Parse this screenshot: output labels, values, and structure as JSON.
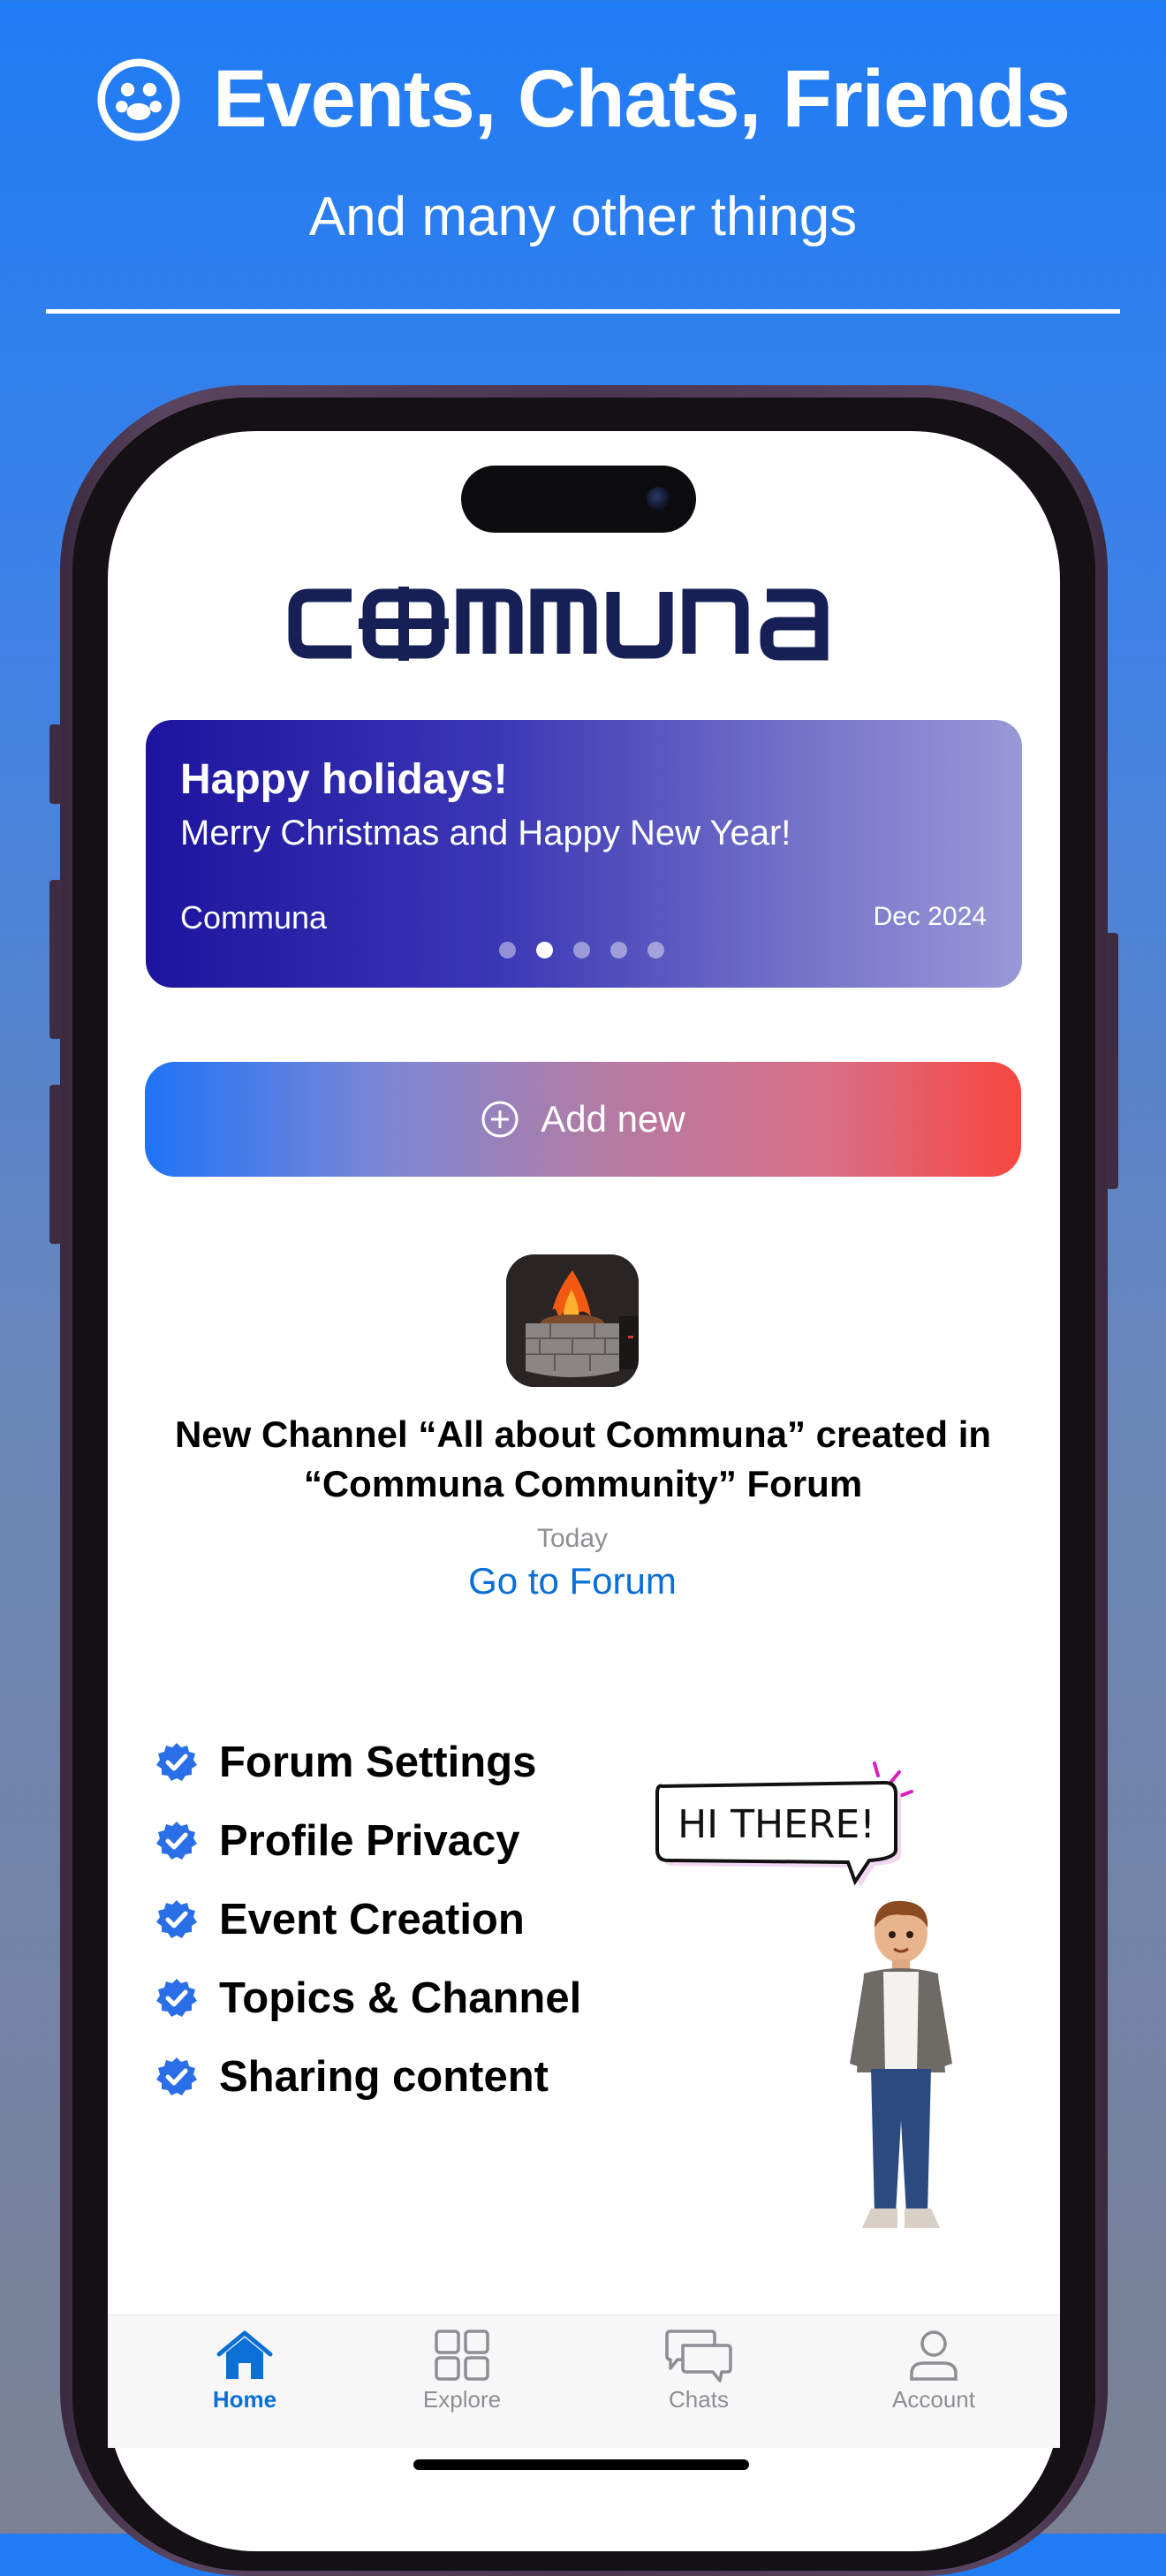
{
  "promo": {
    "headline": "Events, Chats, Friends",
    "subline": "And many other things"
  },
  "app": {
    "brand_name": "communa",
    "banner": {
      "title": "Happy holidays!",
      "subtitle": "Merry Christmas and Happy New Year!",
      "author": "Communa",
      "date": "Dec 2024",
      "page_count": 5,
      "active_page": 2
    },
    "add_new_label": "Add new",
    "feed_item": {
      "title_line1": "New Channel “All about Communa” created in",
      "title_line2": "“Communa Community” Forum",
      "time": "Today",
      "link": "Go to Forum"
    },
    "features": [
      "Forum Settings",
      "Profile Privacy",
      "Event Creation",
      "Topics & Channel",
      "Sharing content"
    ],
    "speech_bubble": "HI THERE!",
    "tabs": [
      {
        "label": "Home",
        "icon": "home-icon",
        "active": true
      },
      {
        "label": "Explore",
        "icon": "grid-icon",
        "active": false
      },
      {
        "label": "Chats",
        "icon": "chat-bubbles-icon",
        "active": false
      },
      {
        "label": "Account",
        "icon": "person-icon",
        "active": false
      }
    ]
  },
  "colors": {
    "accent": "#0a6fd6",
    "brand_navy": "#162056",
    "check_blue": "#2a6fe8"
  }
}
